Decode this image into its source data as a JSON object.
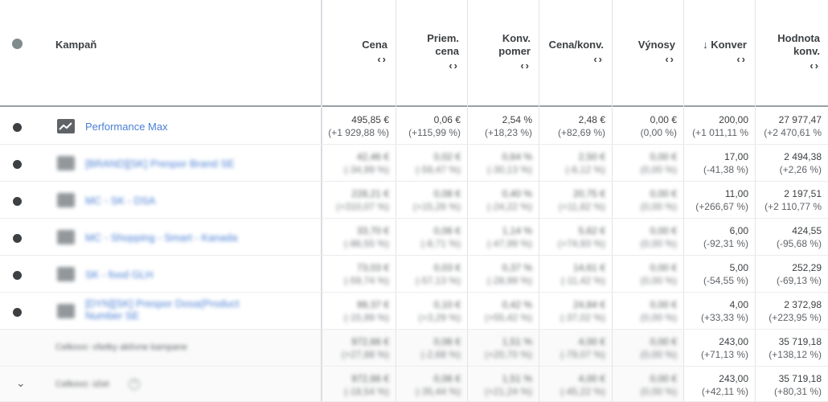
{
  "header": {
    "campaign_label": "Kampaň",
    "columns": [
      {
        "id": "cena",
        "title_lines": [
          "Cena"
        ]
      },
      {
        "id": "priem-cena",
        "title_lines": [
          "Priem.",
          "cena"
        ]
      },
      {
        "id": "konv-pomer",
        "title_lines": [
          "Konv.",
          "pomer"
        ]
      },
      {
        "id": "cena-konv",
        "title_lines": [
          "Cena/konv."
        ]
      },
      {
        "id": "vynosy",
        "title_lines": [
          "Výnosy"
        ]
      },
      {
        "id": "konver",
        "title_lines": [
          "↓ Konver"
        ]
      },
      {
        "id": "hodnota-konv",
        "title_lines": [
          "Hodnota",
          "konv."
        ]
      }
    ],
    "sort_arrows": "‹›"
  },
  "rows": [
    {
      "name": "Performance Max",
      "blurred": false,
      "icon": "performance-max-chart-icon",
      "values": [
        [
          "495,85 €",
          "(+1 929,88 %)"
        ],
        [
          "0,06 €",
          "(+115,99 %)"
        ],
        [
          "2,54 %",
          "(+18,23 %)"
        ],
        [
          "2,48 €",
          "(+82,69 %)"
        ],
        [
          "0,00 €",
          "(0,00 %)"
        ],
        [
          "200,00",
          "(+1 011,11 %"
        ],
        [
          "27 977,47",
          "(+2 470,61 %"
        ]
      ]
    },
    {
      "name": "[BRAND][SK] Prespor Brand SE",
      "blurred": true,
      "icon": "search-campaign-icon",
      "values": [
        [
          "42,46 €",
          "(-34,99 %)"
        ],
        [
          "0,02 €",
          "(-59,47 %)"
        ],
        [
          "0,64 %",
          "(-30,13 %)"
        ],
        [
          "2,50 €",
          "(-6,12 %)"
        ],
        [
          "0,00 €",
          "(0,00 %)"
        ],
        [
          "17,00",
          "(-41,38 %)"
        ],
        [
          "2 494,38",
          "(+2,26 %)"
        ]
      ]
    },
    {
      "name": "MC - SK - DSA",
      "blurred": true,
      "icon": "search-campaign-icon",
      "values": [
        [
          "228,21 €",
          "(+310,07 %)"
        ],
        [
          "0,08 €",
          "(+15,26 %)"
        ],
        [
          "0,40 %",
          "(-24,22 %)"
        ],
        [
          "20,75 €",
          "(+11,82 %)"
        ],
        [
          "0,00 €",
          "(0,00 %)"
        ],
        [
          "11,00",
          "(+266,67 %)"
        ],
        [
          "2 197,51",
          "(+2 110,77 %"
        ]
      ]
    },
    {
      "name": "MC - Shopping - Smart - Kanada",
      "blurred": true,
      "icon": "shopping-campaign-icon",
      "values": [
        [
          "33,70 €",
          "(-86,55 %)"
        ],
        [
          "0,06 €",
          "(-8,71 %)"
        ],
        [
          "1,14 %",
          "(-47,99 %)"
        ],
        [
          "5,62 €",
          "(+74,93 %)"
        ],
        [
          "0,00 €",
          "(0,00 %)"
        ],
        [
          "6,00",
          "(-92,31 %)"
        ],
        [
          "424,55",
          "(-95,68 %)"
        ]
      ]
    },
    {
      "name": "SK - food GLH",
      "blurred": true,
      "icon": "display-campaign-icon",
      "values": [
        [
          "73,03 €",
          "(-59,74 %)"
        ],
        [
          "0,03 €",
          "(-57,13 %)"
        ],
        [
          "0,37 %",
          "(-28,99 %)"
        ],
        [
          "14,61 €",
          "(-11,42 %)"
        ],
        [
          "0,00 €",
          "(0,00 %)"
        ],
        [
          "5,00",
          "(-54,55 %)"
        ],
        [
          "252,29",
          "(-69,13 %)"
        ]
      ]
    },
    {
      "name": "[DYN][SK] Prespor Dosa(Product Number SE",
      "blurred": true,
      "icon": "search-campaign-icon",
      "values": [
        [
          "99,37 €",
          "(-15,99 %)"
        ],
        [
          "0,10 €",
          "(+3,29 %)"
        ],
        [
          "0,42 %",
          "(+55,42 %)"
        ],
        [
          "24,84 €",
          "(-37,02 %)"
        ],
        [
          "0,00 €",
          "(0,00 %)"
        ],
        [
          "4,00",
          "(+33,33 %)"
        ],
        [
          "2 372,98",
          "(+223,95 %)"
        ]
      ]
    }
  ],
  "totals": [
    {
      "label": "Celkovo: všetky aktívne kampane",
      "help": false,
      "values": [
        [
          "972,66 €",
          "(+27,88 %)"
        ],
        [
          "0,06 €",
          "(-2,68 %)"
        ],
        [
          "1,51 %",
          "(+20,70 %)"
        ],
        [
          "4,00 €",
          "(-79,07 %)"
        ],
        [
          "0,00 €",
          "(0,00 %)"
        ],
        [
          "243,00",
          "(+71,13 %)"
        ],
        [
          "35 719,18",
          "(+138,12 %)"
        ]
      ]
    },
    {
      "label": "Celkovo: účet",
      "help": true,
      "values": [
        [
          "972,66 €",
          "(-18,54 %)"
        ],
        [
          "0,06 €",
          "(-35,44 %)"
        ],
        [
          "1,51 %",
          "(+21,24 %)"
        ],
        [
          "4,00 €",
          "(-45,22 %)"
        ],
        [
          "0,00 €",
          "(0,00 %)"
        ],
        [
          "243,00",
          "(+42,11 %)"
        ],
        [
          "35 719,18",
          "(+80,31 %)"
        ]
      ]
    }
  ],
  "colors": {
    "link": "#4a7fd4",
    "text": "#3c4043",
    "muted": "#5f6368",
    "border": "#e3e3e3"
  }
}
